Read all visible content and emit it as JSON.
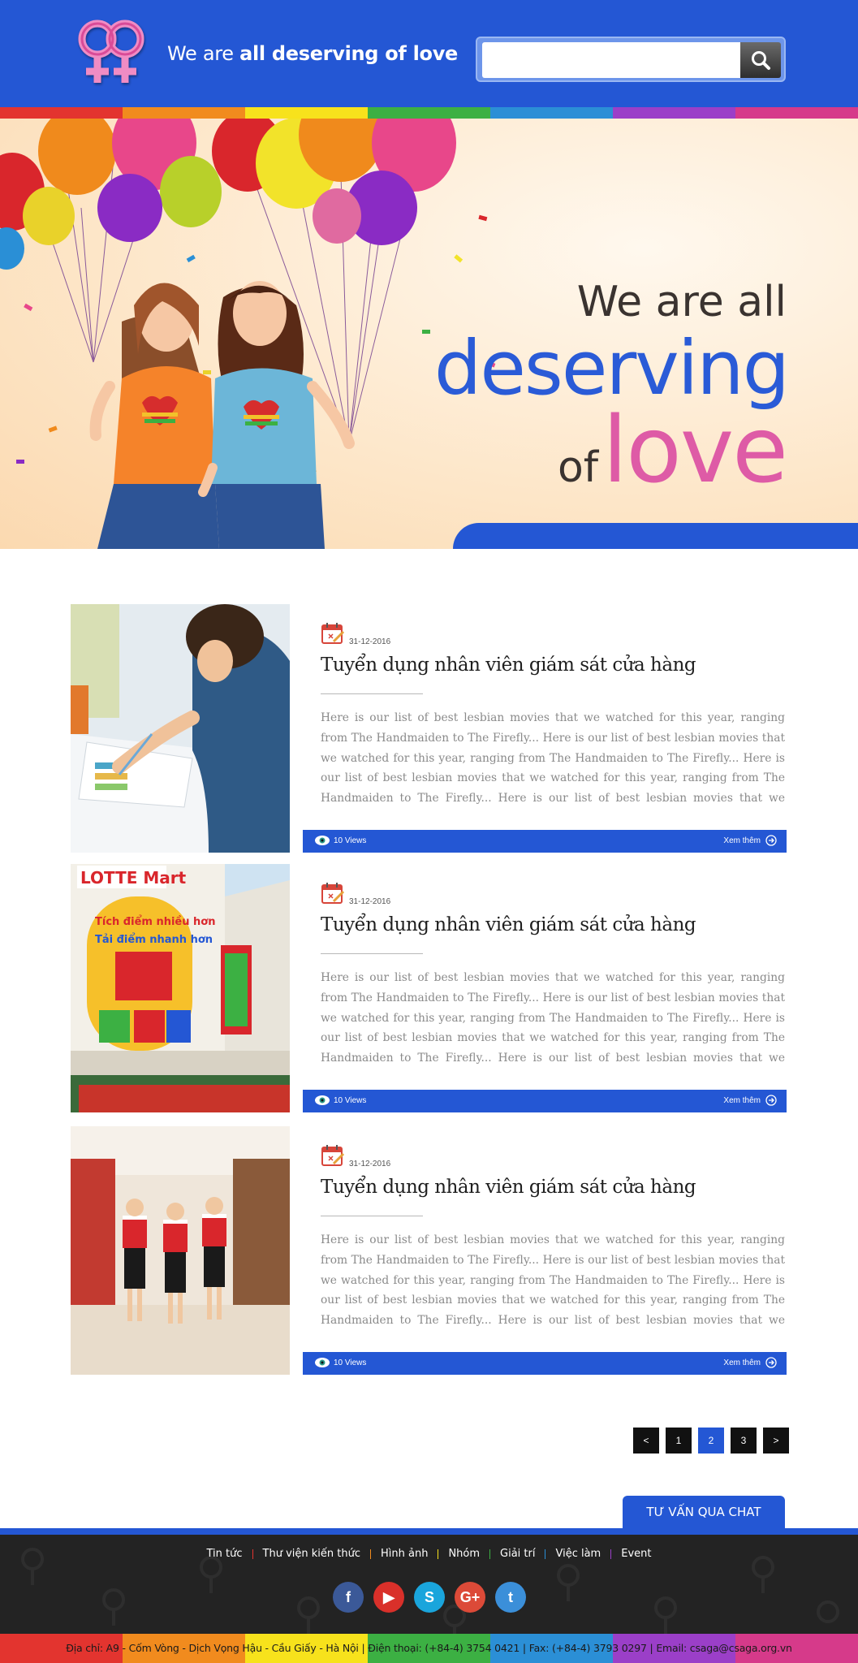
{
  "header": {
    "tagline_pre": "We are ",
    "tagline_bold": "all deserving of love",
    "search_placeholder": "",
    "search_icon": "search-icon"
  },
  "rainbow_colors": [
    "#e3342f",
    "#f18b1e",
    "#f7e21c",
    "#3cb043",
    "#2b8fd6",
    "#9b3fc8",
    "#d63a8a"
  ],
  "banner": {
    "line1": "We are all",
    "line2": "deserving",
    "line3_of": "of",
    "line3_love": "love"
  },
  "articles": [
    {
      "date": "31-12-2016",
      "title": "Tuyển dụng nhân viên giám sát cửa hàng",
      "excerpt": "Here is our list of best lesbian movies that we watched for this year, ranging from The Handmaiden to The Firefly... Here is our list of best lesbian movies that we watched for this year, ranging from The Handmaiden to The Firefly... Here is our list of best lesbian movies that we watched for this year, ranging from The Handmaiden to The Firefly... Here is our list of best lesbian movies that we watched for this year, ranging from The",
      "views": "10 Views",
      "more": "Xem thêm"
    },
    {
      "date": "31-12-2016",
      "title": "Tuyển dụng nhân viên giám sát cửa hàng",
      "excerpt": "Here is our list of best lesbian movies that we watched for this year, ranging from The Handmaiden to The Firefly... Here is our list of best lesbian movies that we watched for this year, ranging from The Handmaiden to The Firefly... Here is our list of best lesbian movies that we watched for this year, ranging from The Handmaiden to The Firefly... Here is our list of best lesbian movies that we watched for this year, ranging from The",
      "views": "10 Views",
      "more": "Xem thêm",
      "image_text": {
        "brand": "LOTTE Mart",
        "lines": [
          "Tích điểm nhiều hơn",
          "Tải điểm nhanh hơn"
        ]
      }
    },
    {
      "date": "31-12-2016",
      "title": "Tuyển dụng nhân viên giám sát cửa hàng",
      "excerpt": "Here is our list of best lesbian movies that we watched for this year, ranging from The Handmaiden to The Firefly... Here is our list of best lesbian movies that we watched for this year, ranging from The Handmaiden to The Firefly... Here is our list of best lesbian movies that we watched for this year, ranging from The Handmaiden to The Firefly... Here is our list of best lesbian movies that we watched for this year, ranging from The",
      "views": "10 Views",
      "more": "Xem thêm"
    }
  ],
  "pagination": {
    "prev": "<",
    "pages": [
      "1",
      "2",
      "3"
    ],
    "active": "2",
    "next": ">"
  },
  "chat_label": "TƯ VẤN QUA CHAT",
  "footer": {
    "nav": [
      "Tin tức",
      "Thư viện kiến thức",
      "Hình ảnh",
      "Nhóm",
      "Giải trí",
      "Việc làm",
      "Event"
    ],
    "separator_colors": [
      "#e3342f",
      "#f18b1e",
      "#f7e21c",
      "#3cb043",
      "#2b8fd6",
      "#9b3fc8"
    ],
    "socials": [
      {
        "name": "facebook-icon",
        "glyph": "f",
        "color": "#3b5998"
      },
      {
        "name": "youtube-icon",
        "glyph": "▶",
        "color": "#d9302a"
      },
      {
        "name": "skype-icon",
        "glyph": "S",
        "color": "#1aa5dc"
      },
      {
        "name": "google-plus-icon",
        "glyph": "G+",
        "color": "#dc4a38"
      },
      {
        "name": "twitter-icon",
        "glyph": "t",
        "color": "#3b8fd9"
      }
    ],
    "address": "Địa chỉ: A9 - Cốm Vòng - Dịch Vọng Hậu - Cầu Giấy - Hà Nội  |  Điện thoại: (+84-4) 3754 0421  |  Fax: (+84-4) 3793 0297  |  Email: csaga@csaga.org.vn"
  }
}
